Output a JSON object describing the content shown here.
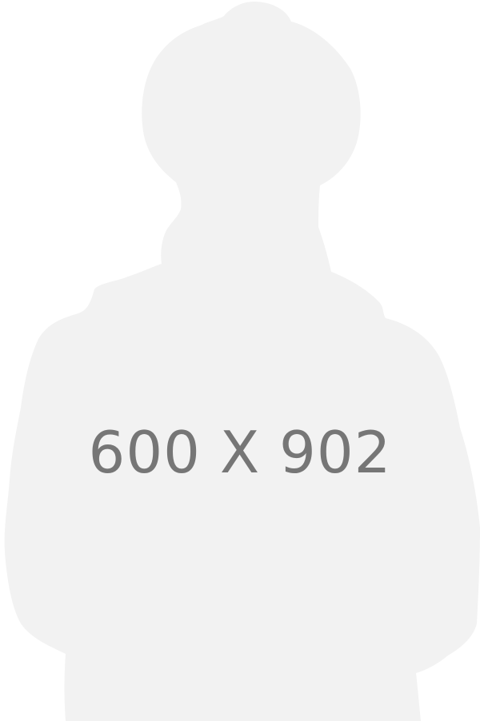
{
  "placeholder": {
    "label": "600 X 902",
    "silhouette_color": "#f2f2f2",
    "label_color": "#767676",
    "background_color": "#ffffff",
    "icon": "person-silhouette-icon"
  }
}
